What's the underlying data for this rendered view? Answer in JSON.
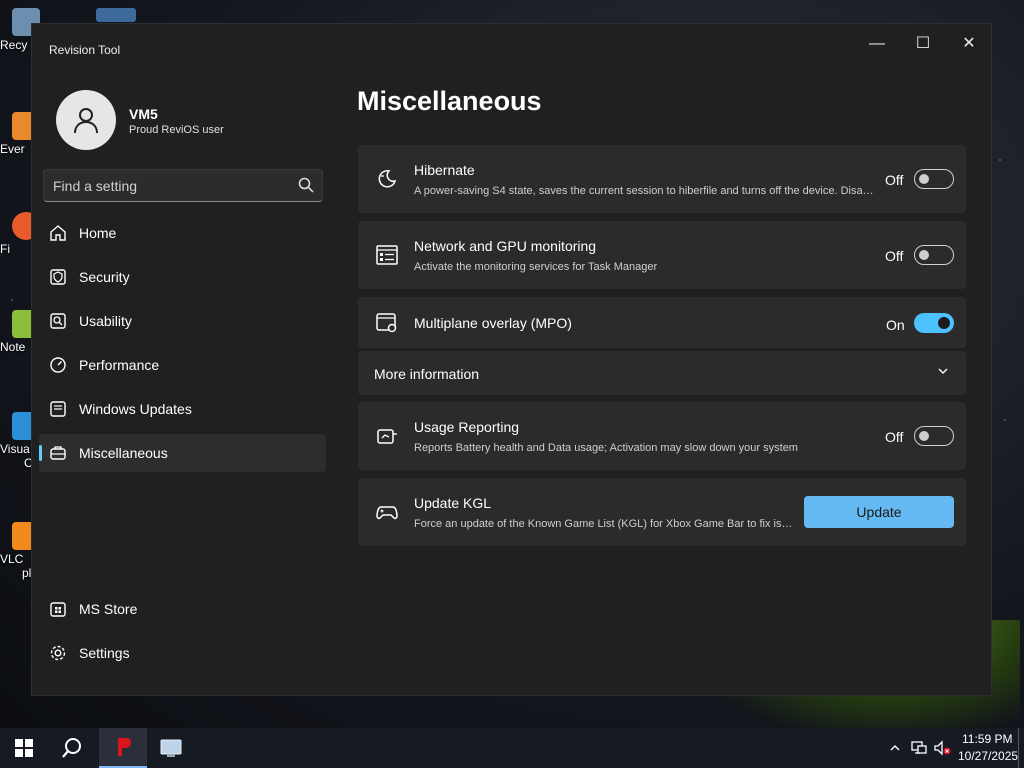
{
  "desktop": {
    "icons": [
      {
        "label": "Recy",
        "color": "#6c8fb0"
      },
      {
        "label": "Ever",
        "color": "#e8892b"
      },
      {
        "label": "Fi",
        "color": "#e85a2b"
      },
      {
        "label": "Note",
        "color": "#8bbf3a"
      },
      {
        "label": "Visua",
        "color": "#2b8fd8"
      },
      {
        "label": "C",
        "color": ""
      },
      {
        "label": "VLC",
        "color": "#f08a1c"
      },
      {
        "label": "pl",
        "color": ""
      }
    ]
  },
  "window": {
    "title": "Revision Tool",
    "controls": {
      "minimize": "—",
      "maximize": "☐",
      "close": "✕"
    }
  },
  "profile": {
    "name": "VM5",
    "subtitle": "Proud ReviOS user"
  },
  "search": {
    "placeholder": "Find a setting"
  },
  "nav": {
    "items": [
      {
        "label": "Home",
        "icon": "home-icon"
      },
      {
        "label": "Security",
        "icon": "shield-icon"
      },
      {
        "label": "Usability",
        "icon": "usability-icon"
      },
      {
        "label": "Performance",
        "icon": "gauge-icon"
      },
      {
        "label": "Windows Updates",
        "icon": "update-icon"
      },
      {
        "label": "Miscellaneous",
        "icon": "toolbox-icon"
      }
    ],
    "active_index": 5,
    "bottom": [
      {
        "label": "MS Store",
        "icon": "store-icon"
      },
      {
        "label": "Settings",
        "icon": "gear-icon"
      }
    ]
  },
  "main": {
    "title": "Miscellaneous",
    "cards": [
      {
        "title": "Hibernate",
        "desc": "A power-saving S4 state, saves the current session to hiberfile and turns off the device. Disabl...",
        "state": "Off"
      },
      {
        "title": "Network and GPU monitoring",
        "desc": "Activate the monitoring services for Task Manager",
        "state": "Off"
      },
      {
        "title": "Multiplane overlay (MPO)",
        "desc": "",
        "state": "On"
      },
      {
        "title": "Usage Reporting",
        "desc": "Reports Battery health and Data usage; Activation may slow down your system",
        "state": "Off"
      }
    ],
    "more_info": "More information",
    "update_kgl": {
      "title": "Update KGL",
      "desc": "Force an update of the Known Game List (KGL) for Xbox Game Bar to fix issu...",
      "button": "Update"
    }
  },
  "taskbar": {
    "time": "11:59 PM",
    "date": "10/27/2025"
  },
  "colors": {
    "accent": "#4cc2ff",
    "button": "#65b9f2",
    "card": "#2b2b2b",
    "window": "#202020"
  }
}
